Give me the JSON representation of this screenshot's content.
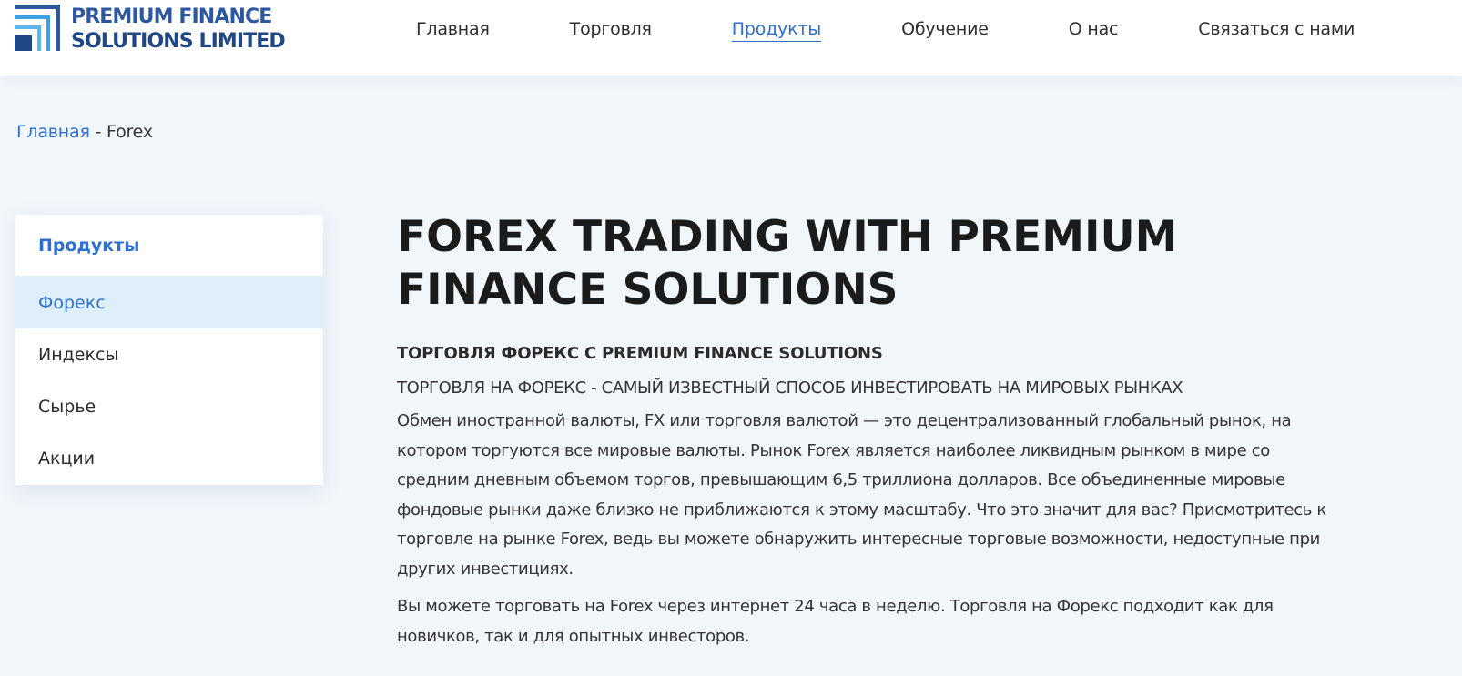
{
  "brand": {
    "line1": "PREMIUM FINANCE",
    "line2": "SOLUTIONS LIMITED",
    "colors": {
      "primary": "#2d58a0",
      "accent": "#3f9fe0",
      "dark": "#1f4786"
    }
  },
  "nav": {
    "items": [
      {
        "label": "Главная",
        "active": false
      },
      {
        "label": "Торговля",
        "active": false
      },
      {
        "label": "Продукты",
        "active": true
      },
      {
        "label": "Обучение",
        "active": false
      },
      {
        "label": "О нас",
        "active": false
      },
      {
        "label": "Связаться с нами",
        "active": false
      }
    ]
  },
  "breadcrumb": {
    "home": "Главная",
    "separator": " - ",
    "current": "Forex"
  },
  "sidebar": {
    "title": "Продукты",
    "items": [
      {
        "label": "Форекс",
        "active": true
      },
      {
        "label": "Индексы",
        "active": false
      },
      {
        "label": "Сырье",
        "active": false
      },
      {
        "label": "Акции",
        "active": false
      }
    ]
  },
  "main": {
    "title": "FOREX TRADING WITH PREMIUM FINANCE SOLUTIONS",
    "subtitle_bold": "ТОРГОВЛЯ ФОРЕКС С PREMIUM FINANCE SOLUTIONS",
    "subtitle_upper": "ТОРГОВЛЯ НА ФОРЕКС - САМЫЙ ИЗВЕСТНЫЙ СПОСОБ ИНВЕСТИРОВАТЬ НА МИРОВЫХ РЫНКАХ",
    "paragraphs": [
      "Обмен иностранной валюты, FX или торговля валютой — это децентрализованный глобальный рынок, на котором торгуются все мировые валюты. Рынок Forex является наиболее ликвидным рынком в мире со средним дневным объемом торгов, превышающим 6,5 триллиона долларов. Все объединенные мировые фондовые рынки даже близко не приближаются к этому масштабу. Что это значит для вас? Присмотритесь к торговле на рынке Forex, ведь вы можете обнаружить интересные торговые возможности, недоступные при других инвестициях.",
      "Вы можете торговать на Forex через интернет 24 часа в неделю. Торговля на Форекс подходит как для новичков, так и для опытных инвесторов."
    ]
  }
}
